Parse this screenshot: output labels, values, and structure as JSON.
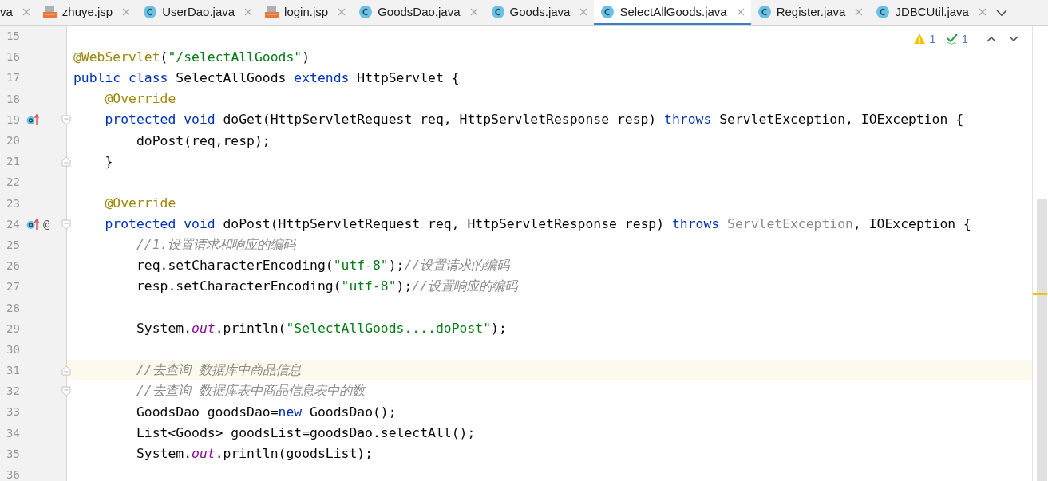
{
  "tabs": [
    {
      "label": "va",
      "selected": false
    },
    {
      "label": "zhuye.jsp",
      "kind": "jsp",
      "selected": false
    },
    {
      "label": "UserDao.java",
      "kind": "class",
      "selected": false
    },
    {
      "label": "login.jsp",
      "kind": "jsp",
      "selected": false
    },
    {
      "label": "GoodsDao.java",
      "kind": "class",
      "selected": false
    },
    {
      "label": "Goods.java",
      "kind": "class",
      "selected": false
    },
    {
      "label": "SelectAllGoods.java",
      "kind": "class",
      "selected": true
    },
    {
      "label": "Register.java",
      "kind": "class",
      "selected": false
    },
    {
      "label": "JDBCUtil.java",
      "kind": "class",
      "selected": false
    }
  ],
  "inspections": {
    "warnings": "1",
    "weak_warnings": "1"
  },
  "lines": [
    {
      "number": "15",
      "current": false,
      "override": false
    },
    {
      "number": "16",
      "current": false,
      "override": false,
      "tokens": [
        {
          "kind": "ann",
          "t": "@WebServlet"
        },
        {
          "kind": "plain",
          "t": "("
        },
        {
          "kind": "str",
          "t": "\"/selectAllGoods\""
        },
        {
          "kind": "plain",
          "t": ")"
        }
      ]
    },
    {
      "number": "17",
      "current": false,
      "override": false,
      "tokens": [
        {
          "kind": "kw",
          "t": "public class "
        },
        {
          "kind": "plain",
          "t": "SelectAllGoods "
        },
        {
          "kind": "kw",
          "t": "extends "
        },
        {
          "kind": "plain",
          "t": "HttpServlet {"
        }
      ]
    },
    {
      "number": "18",
      "current": false,
      "override": false,
      "tokens": [
        {
          "kind": "ann",
          "t": "    @Override"
        }
      ]
    },
    {
      "number": "19",
      "current": false,
      "override": true,
      "fold": {
        "kind": "start"
      },
      "tokens": [
        {
          "kind": "kw",
          "t": "    protected void "
        },
        {
          "kind": "plain",
          "t": "doGet(HttpServletRequest req, HttpServletResponse resp) "
        },
        {
          "kind": "kw",
          "t": "throws "
        },
        {
          "kind": "plain",
          "t": "ServletException, IOException {"
        }
      ]
    },
    {
      "number": "20",
      "current": false,
      "override": false,
      "tokens": [
        {
          "kind": "plain",
          "t": "        doPost(req,resp);"
        }
      ]
    },
    {
      "number": "21",
      "current": false,
      "override": false,
      "fold": {
        "kind": "end"
      },
      "tokens": [
        {
          "kind": "plain",
          "t": "    }"
        }
      ]
    },
    {
      "number": "22",
      "current": false,
      "override": false
    },
    {
      "number": "23",
      "current": false,
      "override": false,
      "tokens": [
        {
          "kind": "ann",
          "t": "    @Override"
        }
      ]
    },
    {
      "number": "24",
      "current": false,
      "override": true,
      "mark": "@",
      "fold": {
        "kind": "start"
      },
      "tokens": [
        {
          "kind": "kw",
          "t": "    protected void "
        },
        {
          "kind": "plain",
          "t": "doPost(HttpServletRequest req, HttpServletResponse resp) "
        },
        {
          "kind": "kw",
          "t": "throws "
        },
        {
          "kind": "dim",
          "t": "ServletException"
        },
        {
          "kind": "plain",
          "t": ", IOException {"
        }
      ]
    },
    {
      "number": "25",
      "current": false,
      "override": false,
      "tokens": [
        {
          "kind": "com",
          "t": "        //1.设置请求和响应的编码"
        }
      ]
    },
    {
      "number": "26",
      "current": false,
      "override": false,
      "tokens": [
        {
          "kind": "plain",
          "t": "        req.setCharacterEncoding("
        },
        {
          "kind": "str",
          "t": "\"utf-8\""
        },
        {
          "kind": "plain",
          "t": ");"
        },
        {
          "kind": "com",
          "t": "//设置请求的编码"
        }
      ]
    },
    {
      "number": "27",
      "current": false,
      "override": false,
      "tokens": [
        {
          "kind": "plain",
          "t": "        resp.setCharacterEncoding("
        },
        {
          "kind": "str",
          "t": "\"utf-8\""
        },
        {
          "kind": "plain",
          "t": ");"
        },
        {
          "kind": "com",
          "t": "//设置响应的编码"
        }
      ]
    },
    {
      "number": "28",
      "current": false,
      "override": false
    },
    {
      "number": "29",
      "current": false,
      "override": false,
      "tokens": [
        {
          "kind": "plain",
          "t": "        System."
        },
        {
          "kind": "field",
          "t": "out"
        },
        {
          "kind": "plain",
          "t": ".println("
        },
        {
          "kind": "str",
          "t": "\"SelectAllGoods....doPost\""
        },
        {
          "kind": "plain",
          "t": ");"
        }
      ]
    },
    {
      "number": "30",
      "current": false,
      "override": false
    },
    {
      "number": "31",
      "current": true,
      "override": false,
      "fold": {
        "kind": "end"
      },
      "tokens": [
        {
          "kind": "com",
          "t": "        //去查询 数据库中商品信息"
        }
      ]
    },
    {
      "number": "32",
      "current": false,
      "override": false,
      "fold": {
        "kind": "start"
      },
      "tokens": [
        {
          "kind": "com",
          "t": "        //去查询 数据库表中商品信息表中的数"
        }
      ]
    },
    {
      "number": "33",
      "current": false,
      "override": false,
      "tokens": [
        {
          "kind": "plain",
          "t": "        GoodsDao goodsDao="
        },
        {
          "kind": "kw",
          "t": "new"
        },
        {
          "kind": "plain",
          "t": " GoodsDao();"
        }
      ]
    },
    {
      "number": "34",
      "current": false,
      "override": false,
      "tokens": [
        {
          "kind": "plain",
          "t": "        List<Goods> goodsList=goodsDao.selectAll();"
        }
      ]
    },
    {
      "number": "35",
      "current": false,
      "override": false,
      "tokens": [
        {
          "kind": "plain",
          "t": "        System."
        },
        {
          "kind": "field",
          "t": "out"
        },
        {
          "kind": "plain",
          "t": ".println(goodsList);"
        }
      ]
    },
    {
      "number": "36",
      "current": false,
      "override": false
    }
  ]
}
